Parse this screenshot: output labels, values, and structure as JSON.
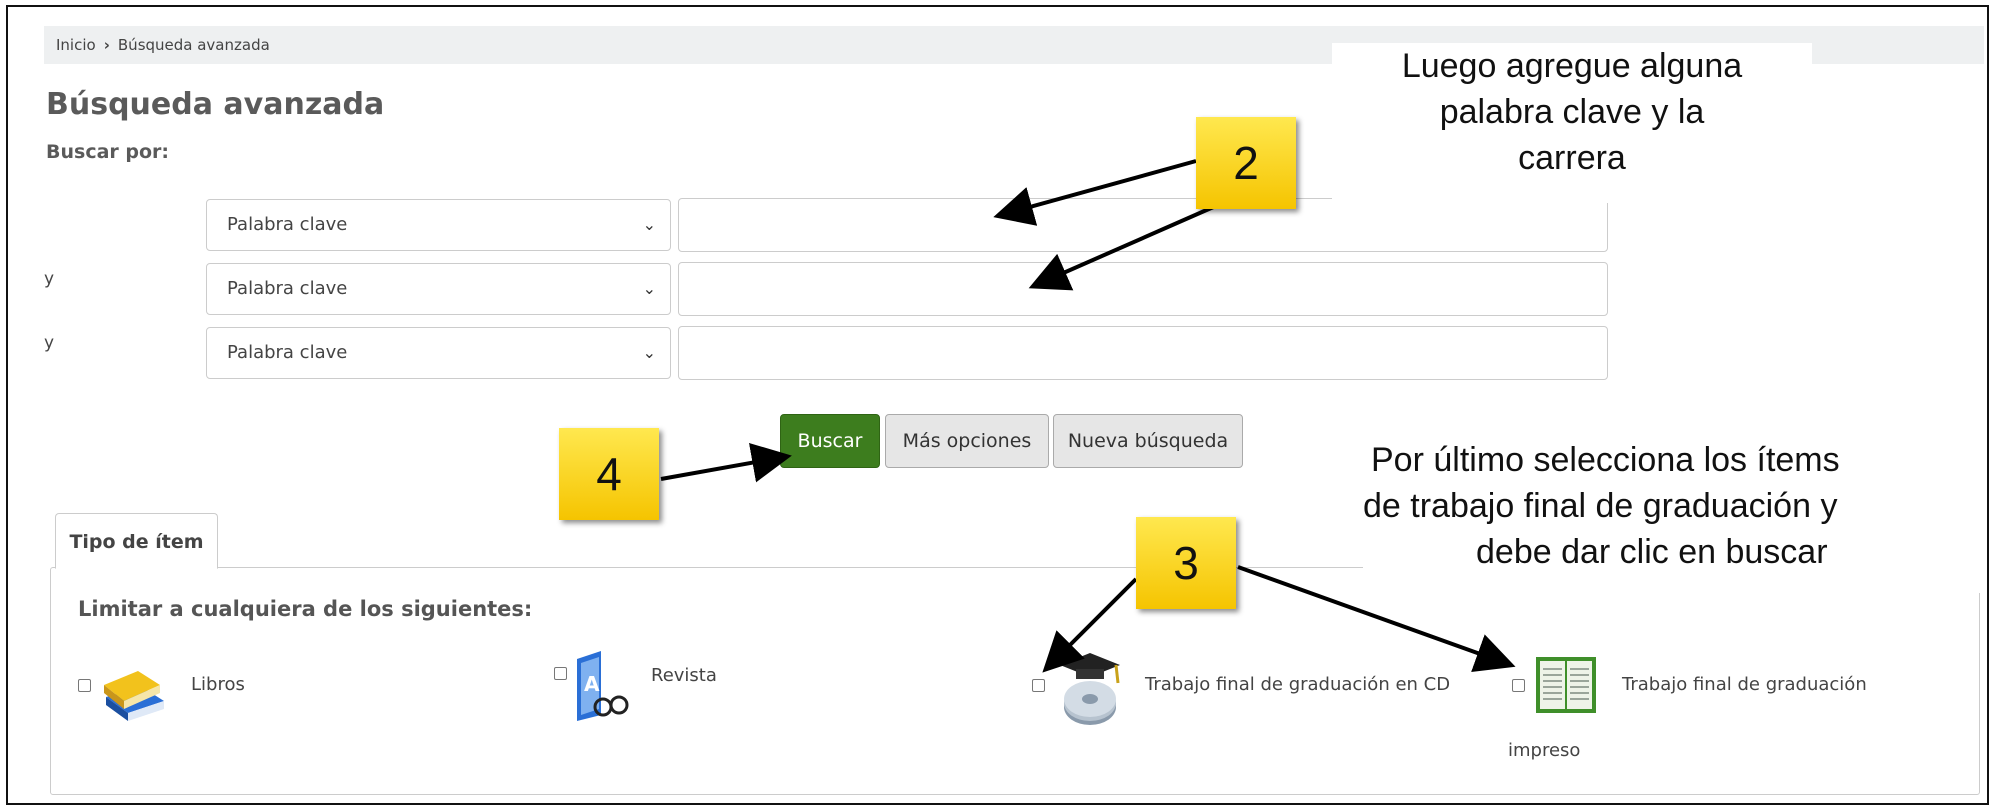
{
  "breadcrumb": {
    "home": "Inicio",
    "current": "Búsqueda avanzada"
  },
  "page": {
    "title": "Búsqueda avanzada",
    "search_by": "Buscar por:"
  },
  "rows": [
    {
      "conj": "",
      "field": "Palabra clave",
      "value": ""
    },
    {
      "conj": "y",
      "field": "Palabra clave",
      "value": ""
    },
    {
      "conj": "y",
      "field": "Palabra clave",
      "value": ""
    }
  ],
  "buttons": {
    "search": "Buscar",
    "more": "Más opciones",
    "new": "Nueva búsqueda"
  },
  "tabs": {
    "item_type": "Tipo de ítem"
  },
  "limit_label": "Limitar a cualquiera de los siguientes:",
  "item_types": [
    {
      "label": "Libros",
      "icon": "books-icon",
      "checked": false
    },
    {
      "label": "Revista",
      "icon": "magazine-icon",
      "checked": false
    },
    {
      "label": "Trabajo final de graduación en CD",
      "icon": "graduation-cd-icon",
      "checked": false
    },
    {
      "label": "Trabajo final de graduación",
      "label2": "impreso",
      "icon": "open-book-icon",
      "checked": false
    }
  ],
  "annotations": {
    "callout_2": "2",
    "callout_3": "3",
    "callout_4": "4",
    "note_top": [
      "Luego agregue alguna",
      "palabra clave y la",
      "carrera"
    ],
    "note_bottom": [
      "Por último selecciona los ítems",
      "de trabajo final de graduación y",
      "debe dar clic en buscar"
    ]
  },
  "colors": {
    "primary_button": "#3d7d1e",
    "callout": "#f5c400"
  }
}
